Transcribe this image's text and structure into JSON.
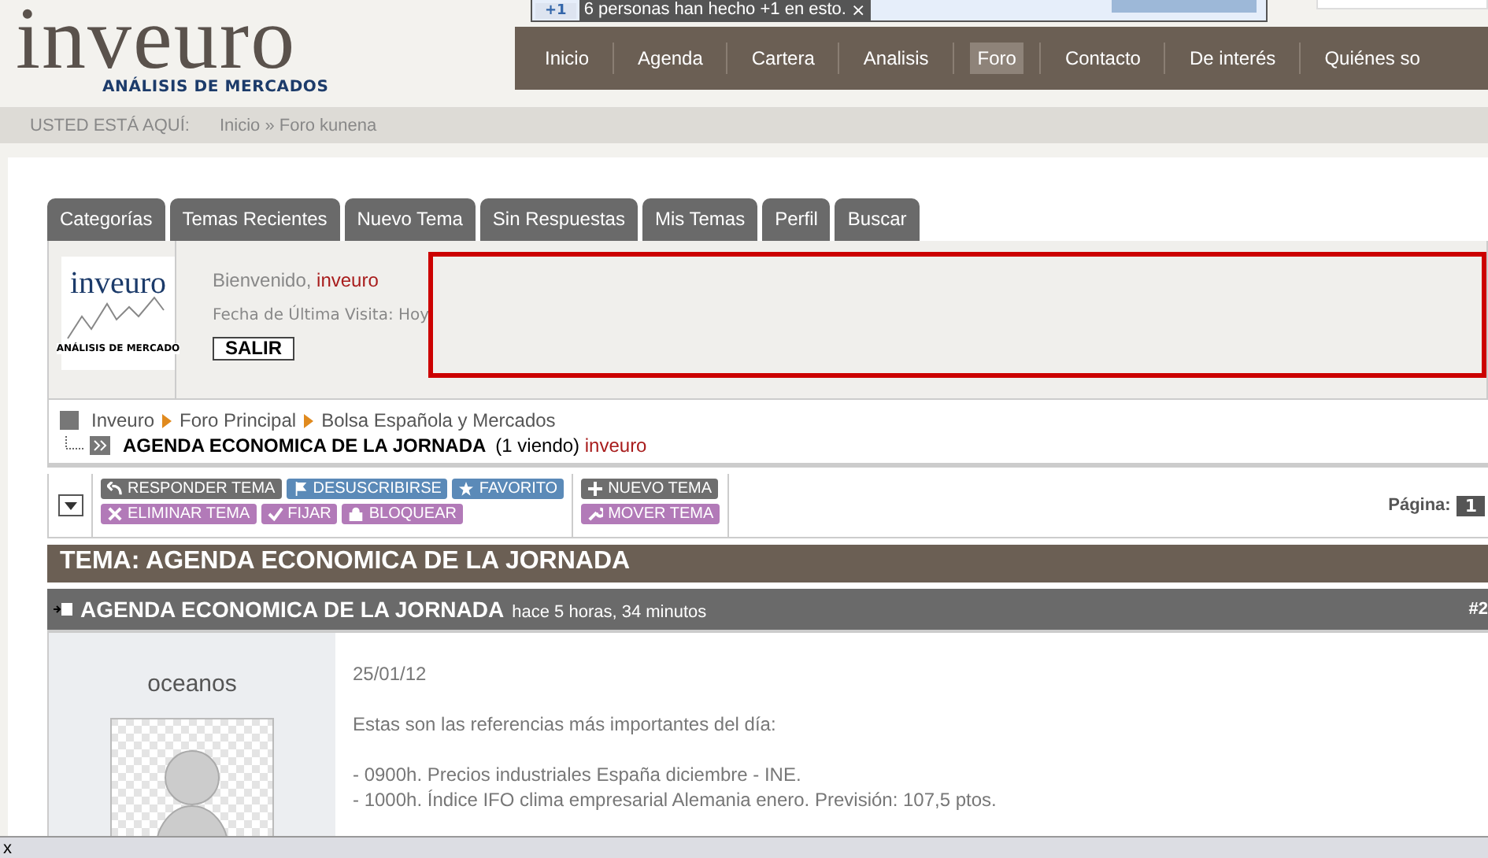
{
  "plusone": {
    "badge": "+1",
    "text": "6 personas han hecho +1 en esto.",
    "close": "×"
  },
  "logo": {
    "name": "inveuro",
    "tagline": "ANÁLISIS DE MERCADOS"
  },
  "nav": [
    {
      "label": "Inicio",
      "selected": false
    },
    {
      "label": "Agenda",
      "selected": false
    },
    {
      "label": "Cartera",
      "selected": false
    },
    {
      "label": "Analisis",
      "selected": false
    },
    {
      "label": "Foro",
      "selected": true
    },
    {
      "label": "Contacto",
      "selected": false
    },
    {
      "label": "De interés",
      "selected": false
    },
    {
      "label": "Quiénes so",
      "selected": false
    }
  ],
  "location": {
    "label": "USTED ESTÁ AQUÍ:",
    "path": "Inicio » Foro kunena"
  },
  "forum_tabs": [
    {
      "label": "Categorías"
    },
    {
      "label": "Temas Recientes"
    },
    {
      "label": "Nuevo Tema"
    },
    {
      "label": "Sin Respuestas"
    },
    {
      "label": "Mis Temas"
    },
    {
      "label": "Perfil"
    },
    {
      "label": "Buscar"
    }
  ],
  "profile": {
    "avatar_text": "inveuro",
    "avatar_tagline": "ANÁLISIS DE MERCADO",
    "welcome": "Bienvenido,",
    "user": "inveuro",
    "last_visit": "Fecha de Última Visita: Hoy",
    "logout": "SALIR"
  },
  "breadcrumb": {
    "items": [
      "Inveuro",
      "Foro Principal",
      "Bolsa Española y Mercados"
    ],
    "topic": "AGENDA ECONOMICA DE LA JORNADA",
    "viewing": "(1 viendo)",
    "viewer": "inveuro"
  },
  "actions": [
    [
      {
        "label": "RESPONDER TEMA",
        "kind": "reply",
        "color": "#6e6e6e"
      },
      {
        "label": "DESUSCRIBIRSE",
        "kind": "flag",
        "color": "#5b8ab8"
      },
      {
        "label": "FAVORITO",
        "kind": "star",
        "color": "#5b8ab8"
      }
    ],
    [
      {
        "label": "ELIMINAR TEMA",
        "kind": "cross",
        "color": "#b27ab8"
      },
      {
        "label": "FIJAR",
        "kind": "check",
        "color": "#b27ab8"
      },
      {
        "label": "BLOQUEAR",
        "kind": "lock",
        "color": "#b27ab8"
      }
    ]
  ],
  "actions2": [
    {
      "label": "NUEVO TEMA",
      "kind": "plus",
      "color": "#6e6e6e"
    },
    {
      "label": "MOVER TEMA",
      "kind": "wrench",
      "color": "#b27ab8"
    }
  ],
  "pagination": {
    "label": "Página:",
    "current": "1"
  },
  "topic_title": "TEMA: AGENDA ECONOMICA DE LA JORNADA",
  "post": {
    "title": "AGENDA ECONOMICA DE LA JORNADA",
    "time": "hace 5 horas, 34 minutos",
    "number": "#2",
    "author": "oceanos",
    "date": "25/01/12",
    "intro": "Estas son las referencias más importantes del día:",
    "lines": [
      "- 0900h. Precios industriales España diciembre - INE.",
      "- 1000h. Índice IFO clima empresarial Alemania enero. Previsión: 107,5 ptos."
    ]
  },
  "bottom_bar": {
    "close": "x"
  }
}
